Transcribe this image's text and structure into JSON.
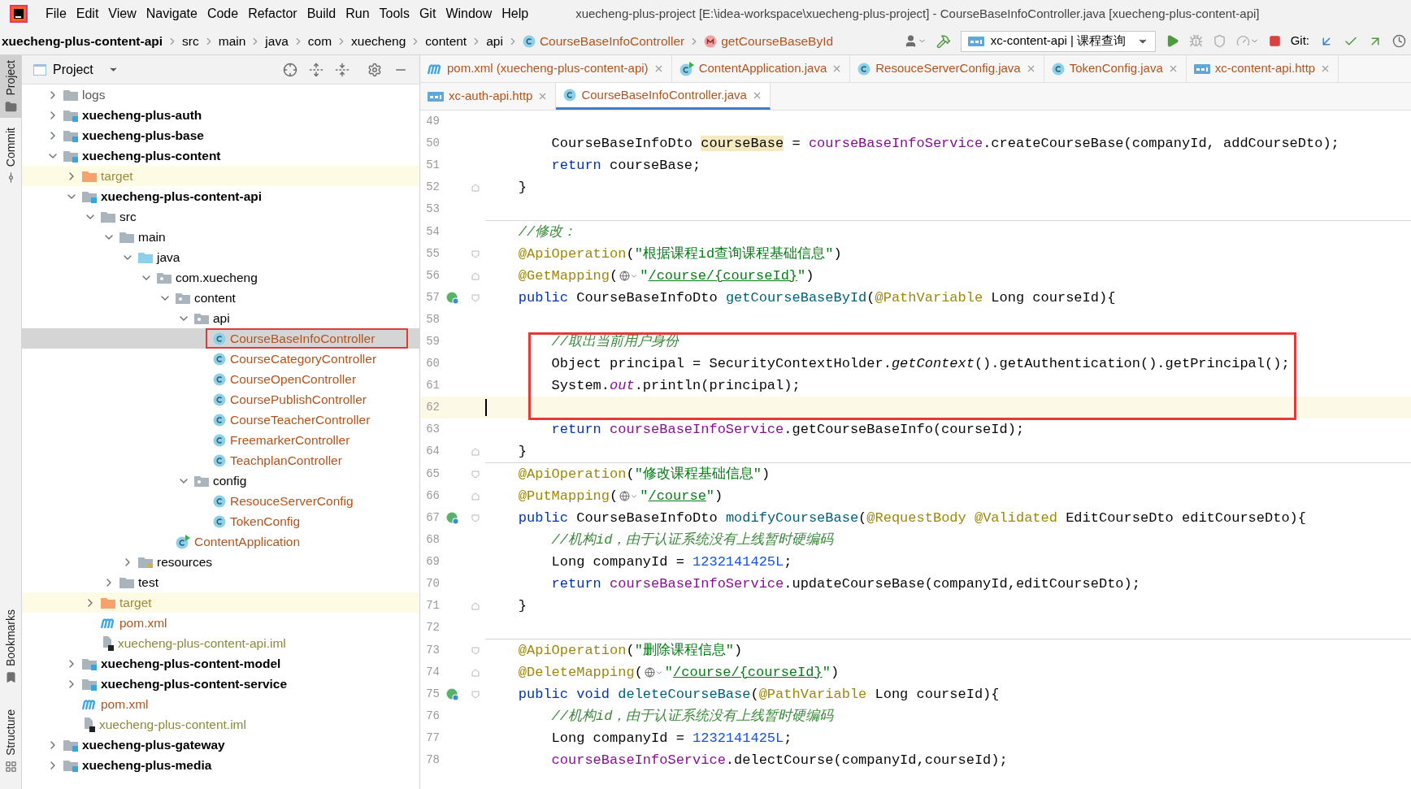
{
  "window": {
    "title": "xuecheng-plus-project [E:\\idea-workspace\\xuecheng-plus-project] - CourseBaseInfoController.java [xuecheng-plus-content-api]"
  },
  "menu": [
    "File",
    "Edit",
    "View",
    "Navigate",
    "Code",
    "Refactor",
    "Build",
    "Run",
    "Tools",
    "Git",
    "Window",
    "Help"
  ],
  "breadcrumb": [
    {
      "text": "xuecheng-plus-content-api",
      "kind": "module"
    },
    {
      "text": "src",
      "kind": "folder"
    },
    {
      "text": "main",
      "kind": "folder"
    },
    {
      "text": "java",
      "kind": "folder"
    },
    {
      "text": "com",
      "kind": "folder"
    },
    {
      "text": "xuecheng",
      "kind": "folder"
    },
    {
      "text": "content",
      "kind": "folder"
    },
    {
      "text": "api",
      "kind": "folder"
    },
    {
      "text": "CourseBaseInfoController",
      "kind": "class"
    },
    {
      "text": "getCourseBaseById",
      "kind": "method"
    }
  ],
  "run_config": {
    "label": "xc-content-api | 课程查询"
  },
  "git_label": "Git:",
  "side_stripe": [
    {
      "label": "Project",
      "selected": true,
      "kind": "top"
    },
    {
      "label": "Commit",
      "selected": false,
      "kind": "top"
    },
    {
      "label": "Bookmarks",
      "selected": false,
      "kind": "bottom"
    },
    {
      "label": "Structure",
      "selected": false,
      "kind": "bottom"
    }
  ],
  "project_panel": {
    "title": "Project"
  },
  "tree": [
    {
      "label": "logs",
      "kind": "folder",
      "color": "#5a5a5a",
      "expanded": false,
      "selected": false
    },
    {
      "label": "xuecheng-plus-auth",
      "kind": "module",
      "color": "#000000",
      "expanded": false,
      "selected": false
    },
    {
      "label": "xuecheng-plus-base",
      "kind": "module",
      "color": "#000000",
      "expanded": false,
      "selected": false
    },
    {
      "label": "xuecheng-plus-content",
      "kind": "module",
      "color": "#000000",
      "expanded": true,
      "selected": false,
      "children": [
        {
          "label": "target",
          "kind": "excluded",
          "color": "#9e8a3a",
          "expanded": false,
          "selected": false
        },
        {
          "label": "xuecheng-plus-content-api",
          "kind": "module",
          "color": "#000000",
          "expanded": true,
          "selected": false,
          "children": [
            {
              "label": "src",
              "kind": "folder",
              "color": "#000000",
              "expanded": true,
              "selected": false,
              "children": [
                {
                  "label": "main",
                  "kind": "folder",
                  "color": "#000000",
                  "expanded": true,
                  "selected": false,
                  "children": [
                    {
                      "label": "java",
                      "kind": "source-root",
                      "color": "#000000",
                      "expanded": true,
                      "selected": false,
                      "children": [
                        {
                          "label": "com.xuecheng",
                          "kind": "package",
                          "color": "#000000",
                          "expanded": true,
                          "selected": false,
                          "children": [
                            {
                              "label": "content",
                              "kind": "package",
                              "color": "#000000",
                              "expanded": true,
                              "selected": false,
                              "children": [
                                {
                                  "label": "api",
                                  "kind": "package",
                                  "color": "#000000",
                                  "expanded": true,
                                  "selected": false,
                                  "children": [
                                    {
                                      "label": "CourseBaseInfoController",
                                      "kind": "class",
                                      "color": "#b3541e",
                                      "selected": true,
                                      "boxed": true
                                    },
                                    {
                                      "label": "CourseCategoryController",
                                      "kind": "class",
                                      "color": "#b3541e",
                                      "selected": false,
                                      "boxed": false
                                    },
                                    {
                                      "label": "CourseOpenController",
                                      "kind": "class",
                                      "color": "#b3541e",
                                      "selected": false,
                                      "boxed": false
                                    },
                                    {
                                      "label": "CoursePublishController",
                                      "kind": "class",
                                      "color": "#b3541e",
                                      "selected": false,
                                      "boxed": false
                                    },
                                    {
                                      "label": "CourseTeacherController",
                                      "kind": "class",
                                      "color": "#b3541e",
                                      "selected": false,
                                      "boxed": false
                                    },
                                    {
                                      "label": "FreemarkerController",
                                      "kind": "class",
                                      "color": "#b3541e",
                                      "selected": false,
                                      "boxed": false
                                    },
                                    {
                                      "label": "TeachplanController",
                                      "kind": "class",
                                      "color": "#b3541e",
                                      "selected": false,
                                      "boxed": false
                                    }
                                  ]
                                },
                                {
                                  "label": "config",
                                  "kind": "package",
                                  "color": "#000000",
                                  "expanded": true,
                                  "selected": false,
                                  "children": [
                                    {
                                      "label": "ResouceServerConfig",
                                      "kind": "class",
                                      "color": "#b3541e",
                                      "selected": false,
                                      "boxed": false
                                    },
                                    {
                                      "label": "TokenConfig",
                                      "kind": "class",
                                      "color": "#b3541e",
                                      "selected": false,
                                      "boxed": false
                                    }
                                  ]
                                }
                              ]
                            },
                            {
                              "label": "ContentApplication",
                              "kind": "app-class",
                              "color": "#b3541e",
                              "selected": false,
                              "boxed": false
                            }
                          ]
                        }
                      ]
                    },
                    {
                      "label": "resources",
                      "kind": "resources-root",
                      "color": "#000000",
                      "expanded": false,
                      "selected": false
                    }
                  ]
                },
                {
                  "label": "test",
                  "kind": "folder",
                  "color": "#000000",
                  "expanded": false,
                  "selected": false
                }
              ]
            },
            {
              "label": "target",
              "kind": "excluded",
              "color": "#9e8a3a",
              "expanded": false,
              "selected": false
            },
            {
              "label": "pom.xml",
              "kind": "maven",
              "color": "#b3541e",
              "selected": false,
              "boxed": false
            },
            {
              "label": "xuecheng-plus-content-api.iml",
              "kind": "iml",
              "color": "#8c8a3c",
              "selected": false,
              "boxed": false
            }
          ]
        },
        {
          "label": "xuecheng-plus-content-model",
          "kind": "module",
          "color": "#000000",
          "expanded": false,
          "selected": false
        },
        {
          "label": "xuecheng-plus-content-service",
          "kind": "module",
          "color": "#000000",
          "expanded": false,
          "selected": false
        },
        {
          "label": "pom.xml",
          "kind": "maven",
          "color": "#b3541e",
          "selected": false,
          "boxed": false
        },
        {
          "label": "xuecheng-plus-content.iml",
          "kind": "iml",
          "color": "#8c8a3c",
          "selected": false,
          "boxed": false
        }
      ]
    },
    {
      "label": "xuecheng-plus-gateway",
      "kind": "module",
      "color": "#000000",
      "expanded": false,
      "selected": false
    },
    {
      "label": "xuecheng-plus-media",
      "kind": "module",
      "color": "#000000",
      "expanded": false,
      "selected": false
    }
  ],
  "tabs": [
    [
      {
        "label": "pom.xml (xuecheng-plus-content-api)",
        "kind": "maven",
        "selected": false
      },
      {
        "label": "ContentApplication.java",
        "kind": "app-class",
        "selected": false
      },
      {
        "label": "ResouceServerConfig.java",
        "kind": "class",
        "selected": false
      },
      {
        "label": "TokenConfig.java",
        "kind": "class",
        "selected": false
      },
      {
        "label": "xc-content-api.http",
        "kind": "api",
        "selected": false
      }
    ],
    [
      {
        "label": "xc-auth-api.http",
        "kind": "api",
        "selected": false
      },
      {
        "label": "CourseBaseInfoController.java",
        "kind": "class",
        "selected": true
      }
    ]
  ],
  "code": {
    "lines": [
      {
        "number": "49",
        "kind": "plain",
        "current": false
      },
      {
        "number": "50",
        "kind": "plain",
        "tokens": [
          {
            "kind": "plain",
            "text": "        CourseBaseInfoDto "
          },
          {
            "kind": "match",
            "text": "courseBase"
          },
          {
            "kind": "plain",
            "text": " = "
          },
          {
            "kind": "field",
            "text": "courseBaseInfoService"
          },
          {
            "kind": "plain",
            "text": ".createCourseBase(companyId, addCourseDto);"
          }
        ],
        "current": false
      },
      {
        "number": "51",
        "kind": "plain",
        "tokens": [
          {
            "kind": "keyword",
            "text": "        return"
          },
          {
            "kind": "plain",
            "text": " courseBase;"
          }
        ],
        "current": false
      },
      {
        "number": "52",
        "kind": "fold_end",
        "tokens": [
          {
            "kind": "plain",
            "text": "    }"
          }
        ],
        "current": false
      },
      {
        "number": "53",
        "kind": "plain",
        "current": false
      },
      {
        "kind": "separator"
      },
      {
        "number": "54",
        "kind": "plain",
        "tokens": [
          {
            "kind": "comment",
            "text": "    //修改："
          }
        ],
        "current": false
      },
      {
        "number": "55",
        "kind": "fold_start",
        "tokens": [
          {
            "kind": "annotation",
            "text": "    @ApiOperation"
          },
          {
            "kind": "plain",
            "text": "("
          },
          {
            "kind": "string",
            "text": "\"根据课程id查询课程基础信息\""
          },
          {
            "kind": "plain",
            "text": ")"
          }
        ],
        "current": false
      },
      {
        "number": "56",
        "kind": "fold_end",
        "tokens": [
          {
            "kind": "annotation",
            "text": "    @GetMapping"
          },
          {
            "kind": "plain",
            "text": "("
          },
          {
            "kind": "globe"
          },
          {
            "kind": "string",
            "text": "\""
          },
          {
            "kind": "url",
            "text": "/course/{courseId}"
          },
          {
            "kind": "string",
            "text": "\""
          },
          {
            "kind": "plain",
            "text": ")"
          }
        ],
        "current": false
      },
      {
        "number": "57",
        "kind": "method_header",
        "tokens": [
          {
            "kind": "keyword",
            "text": "    public"
          },
          {
            "kind": "plain",
            "text": " CourseBaseInfoDto "
          },
          {
            "kind": "method_decl",
            "text": "getCourseBaseById"
          },
          {
            "kind": "plain",
            "text": "("
          },
          {
            "kind": "annotation",
            "text": "@PathVariable"
          },
          {
            "kind": "plain",
            "text": " Long courseId){"
          }
        ],
        "current": false
      },
      {
        "number": "58",
        "kind": "plain",
        "current": false
      },
      {
        "kind": "highlight_group",
        "lines": [
          {
            "number": "59",
            "kind": "plain",
            "tokens": [
              {
                "kind": "comment",
                "text": "        //取出当前用户身份"
              }
            ],
            "current": false
          },
          {
            "number": "60",
            "kind": "plain",
            "tokens": [
              {
                "kind": "plain",
                "text": "        Object principal = SecurityContextHolder."
              },
              {
                "kind": "italic_call",
                "text": "getContext"
              },
              {
                "kind": "plain",
                "text": "().getAuthentication().getPrincipal();"
              }
            ],
            "current": false
          },
          {
            "number": "61",
            "kind": "plain",
            "tokens": [
              {
                "kind": "plain",
                "text": "        System."
              },
              {
                "kind": "static_field",
                "text": "out"
              },
              {
                "kind": "plain",
                "text": ".println(principal);"
              }
            ],
            "current": false
          },
          {
            "number": "62",
            "kind": "plain",
            "current": true
          }
        ]
      },
      {
        "number": "63",
        "kind": "plain",
        "tokens": [
          {
            "kind": "keyword",
            "text": "        return"
          },
          {
            "kind": "field",
            "text": " courseBaseInfoService"
          },
          {
            "kind": "plain",
            "text": ".getCourseBaseInfo(courseId);"
          }
        ],
        "current": false
      },
      {
        "number": "64",
        "kind": "fold_end",
        "tokens": [
          {
            "kind": "plain",
            "text": "    }"
          }
        ],
        "current": false
      },
      {
        "kind": "separator"
      },
      {
        "number": "65",
        "kind": "fold_start",
        "tokens": [
          {
            "kind": "annotation",
            "text": "    @ApiOperation"
          },
          {
            "kind": "plain",
            "text": "("
          },
          {
            "kind": "string",
            "text": "\"修改课程基础信息\""
          },
          {
            "kind": "plain",
            "text": ")"
          }
        ],
        "current": false
      },
      {
        "number": "66",
        "kind": "fold_end",
        "tokens": [
          {
            "kind": "annotation",
            "text": "    @PutMapping"
          },
          {
            "kind": "plain",
            "text": "("
          },
          {
            "kind": "globe"
          },
          {
            "kind": "string",
            "text": "\""
          },
          {
            "kind": "url",
            "text": "/course"
          },
          {
            "kind": "string",
            "text": "\""
          },
          {
            "kind": "plain",
            "text": ")"
          }
        ],
        "current": false
      },
      {
        "number": "67",
        "kind": "method_header",
        "tokens": [
          {
            "kind": "keyword",
            "text": "    public"
          },
          {
            "kind": "plain",
            "text": " CourseBaseInfoDto "
          },
          {
            "kind": "method_decl",
            "text": "modifyCourseBase"
          },
          {
            "kind": "plain",
            "text": "("
          },
          {
            "kind": "annotation",
            "text": "@RequestBody @Validated"
          },
          {
            "kind": "plain",
            "text": " EditCourseDto editCourseDto){"
          }
        ],
        "current": false
      },
      {
        "number": "68",
        "kind": "plain",
        "tokens": [
          {
            "kind": "comment",
            "text": "        //机构id，由于认证系统没有上线暂时硬编码"
          }
        ],
        "current": false
      },
      {
        "number": "69",
        "kind": "plain",
        "tokens": [
          {
            "kind": "plain",
            "text": "        Long companyId = "
          },
          {
            "kind": "number",
            "text": "1232141425L"
          },
          {
            "kind": "plain",
            "text": ";"
          }
        ],
        "current": false
      },
      {
        "number": "70",
        "kind": "plain",
        "tokens": [
          {
            "kind": "keyword",
            "text": "        return"
          },
          {
            "kind": "field",
            "text": " courseBaseInfoService"
          },
          {
            "kind": "plain",
            "text": ".updateCourseBase(companyId,editCourseDto);"
          }
        ],
        "current": false
      },
      {
        "number": "71",
        "kind": "fold_end",
        "tokens": [
          {
            "kind": "plain",
            "text": "    }"
          }
        ],
        "current": false
      },
      {
        "number": "72",
        "kind": "plain",
        "current": false
      },
      {
        "kind": "separator"
      },
      {
        "number": "73",
        "kind": "fold_start",
        "tokens": [
          {
            "kind": "annotation",
            "text": "    @ApiOperation"
          },
          {
            "kind": "plain",
            "text": "("
          },
          {
            "kind": "string",
            "text": "\"删除课程信息\""
          },
          {
            "kind": "plain",
            "text": ")"
          }
        ],
        "current": false
      },
      {
        "number": "74",
        "kind": "fold_end",
        "tokens": [
          {
            "kind": "annotation",
            "text": "    @DeleteMapping"
          },
          {
            "kind": "plain",
            "text": "("
          },
          {
            "kind": "globe"
          },
          {
            "kind": "string",
            "text": "\""
          },
          {
            "kind": "url",
            "text": "/course/{courseId}"
          },
          {
            "kind": "string",
            "text": "\""
          },
          {
            "kind": "plain",
            "text": ")"
          }
        ],
        "current": false
      },
      {
        "number": "75",
        "kind": "method_header",
        "tokens": [
          {
            "kind": "keyword",
            "text": "    public void"
          },
          {
            "kind": "method_decl",
            "text": " deleteCourseBase"
          },
          {
            "kind": "plain",
            "text": "("
          },
          {
            "kind": "annotation",
            "text": "@PathVariable"
          },
          {
            "kind": "plain",
            "text": " Long courseId){"
          }
        ],
        "current": false
      },
      {
        "number": "76",
        "kind": "plain",
        "tokens": [
          {
            "kind": "comment",
            "text": "        //机构id，由于认证系统没有上线暂时硬编码"
          }
        ],
        "current": false
      },
      {
        "number": "77",
        "kind": "plain",
        "tokens": [
          {
            "kind": "plain",
            "text": "        Long companyId = "
          },
          {
            "kind": "number",
            "text": "1232141425L"
          },
          {
            "kind": "plain",
            "text": ";"
          }
        ],
        "current": false
      },
      {
        "number": "78",
        "kind": "plain",
        "tokens": [
          {
            "kind": "field",
            "text": "        courseBaseInfoService"
          },
          {
            "kind": "plain",
            "text": ".delectCourse(companyId,courseId);"
          }
        ],
        "current": false
      }
    ]
  }
}
